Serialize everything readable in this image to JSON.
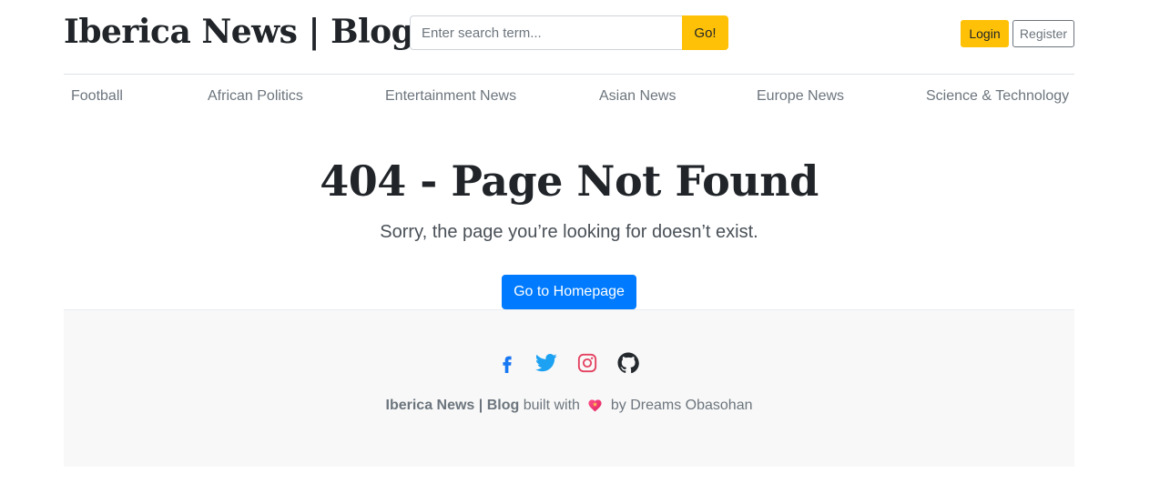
{
  "header": {
    "brand": "Iberica News | Blog",
    "search_placeholder": "Enter search term...",
    "search_button": "Go!",
    "login_label": "Login",
    "register_label": "Register"
  },
  "nav": {
    "items": [
      {
        "label": "Football"
      },
      {
        "label": "African Politics"
      },
      {
        "label": "Entertainment News"
      },
      {
        "label": "Asian News"
      },
      {
        "label": "Europe News"
      },
      {
        "label": "Science & Technology"
      }
    ]
  },
  "main": {
    "title": "404 - Page Not Found",
    "subtitle": "Sorry, the page you’re looking for doesn’t exist.",
    "home_button": "Go to Homepage"
  },
  "footer": {
    "social": [
      {
        "icon": "facebook-icon",
        "color": "#1877f2"
      },
      {
        "icon": "twitter-icon",
        "color": "#1da1f2"
      },
      {
        "icon": "instagram-icon",
        "color": "#e4405f"
      },
      {
        "icon": "github-icon",
        "color": "#24292e"
      }
    ],
    "brand": "Iberica News | Blog",
    "built_with": "built with",
    "by_author": "by Dreams Obasohan"
  },
  "colors": {
    "accent": "#ffc107",
    "primary": "#007bff"
  }
}
